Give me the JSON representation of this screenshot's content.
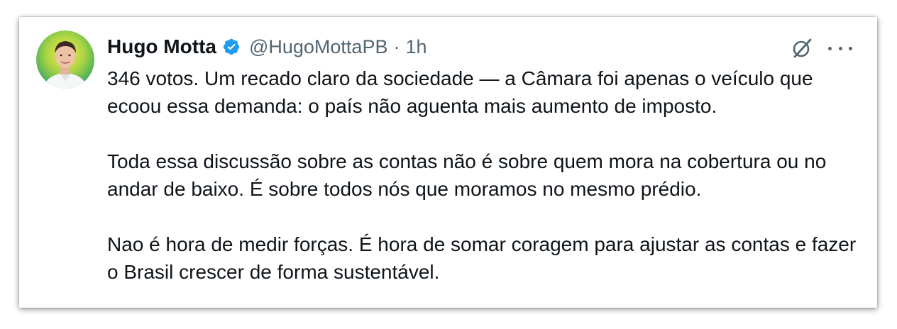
{
  "author": {
    "name": "Hugo Motta",
    "handle": "@HugoMottaPB",
    "separator": "·",
    "time": "1h",
    "verified_icon": "verified-badge-icon",
    "verified_color": "#1d9bf0"
  },
  "actions": {
    "grok_icon": "grok-icon",
    "more_icon": "more-options-icon"
  },
  "tweet": {
    "paragraphs": [
      "346 votos. Um recado claro da sociedade  — a Câmara foi apenas o veículo que ecoou essa demanda: o país não aguenta mais aumento de imposto.",
      "Toda essa discussão sobre as contas não é sobre quem mora na cobertura ou no andar de baixo. É sobre todos nós que moramos no mesmo prédio.",
      "Nao é hora de medir forças. É hora de somar coragem para ajustar as contas e fazer o Brasil crescer de forma sustentável."
    ]
  },
  "colors": {
    "text": "#0f1419",
    "secondary_text": "#536471",
    "avatar_ring": "#f2c230",
    "avatar_bg": "#7cc243"
  }
}
